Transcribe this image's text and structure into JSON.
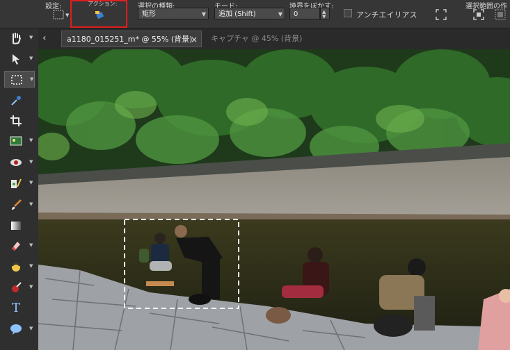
{
  "options_bar": {
    "preset_label": "設定:",
    "action_label": "アクション:",
    "selection_type_label": "選択の種類:",
    "selection_type_value": "矩形",
    "mode_label": "モード:",
    "mode_value": "追加 (Shift)",
    "feather_label": "境界をぼかす:",
    "feather_value": "0",
    "antialias_label": "アンチエイリアス",
    "antialias_checked": false,
    "selection_edit_label": "選択範囲の作"
  },
  "tabs": [
    {
      "label": "a1180_015251_m* @  55% (背景)",
      "active": true
    },
    {
      "label": "キャプチャ @  45% (背景)",
      "active": false
    }
  ],
  "tools": [
    {
      "name": "hand-tool",
      "icon": "hand-icon"
    },
    {
      "name": "move-tool",
      "icon": "arrow-pointer-icon"
    },
    {
      "name": "marquee-tool",
      "icon": "rectangle-marquee-icon",
      "selected": true
    },
    {
      "name": "eyedropper-tool",
      "icon": "eyedropper-icon"
    },
    {
      "name": "crop-tool",
      "icon": "crop-icon"
    },
    {
      "name": "image-tool",
      "icon": "picture-icon"
    },
    {
      "name": "redeye-tool",
      "icon": "eye-icon"
    },
    {
      "name": "adjust-tool",
      "icon": "wand-icon"
    },
    {
      "name": "brush-tool",
      "icon": "brush-icon"
    },
    {
      "name": "gradient-tool",
      "icon": "gradient-icon"
    },
    {
      "name": "eraser-tool",
      "icon": "eraser-icon"
    },
    {
      "name": "fill-tool",
      "icon": "fill-icon"
    },
    {
      "name": "clone-tool",
      "icon": "stamp-icon"
    },
    {
      "name": "text-tool",
      "icon": "text-T-icon",
      "glyph": "T"
    },
    {
      "name": "shape-tool",
      "icon": "speech-bubble-icon"
    }
  ],
  "colors": {
    "selection_highlight": "#e01e1e",
    "accent": "#3d7fd1"
  }
}
